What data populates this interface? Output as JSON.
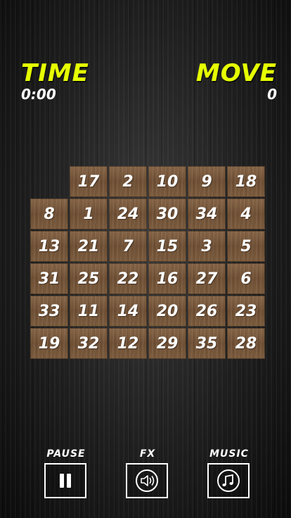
{
  "hud": {
    "time_label": "TIME",
    "time_value": "0:00",
    "move_label": "MOVE",
    "move_value": "0"
  },
  "board": {
    "rows": 6,
    "cols": 6,
    "empty_index": 0,
    "tiles": [
      "",
      "17",
      "2",
      "10",
      "9",
      "18",
      "8",
      "1",
      "24",
      "30",
      "34",
      "4",
      "13",
      "21",
      "7",
      "15",
      "3",
      "5",
      "31",
      "25",
      "22",
      "16",
      "27",
      "6",
      "33",
      "11",
      "14",
      "20",
      "26",
      "23",
      "19",
      "32",
      "12",
      "29",
      "35",
      "28"
    ]
  },
  "controls": {
    "pause_label": "PAUSE",
    "fx_label": "FX",
    "music_label": "MUSIC",
    "pause_icon": "pause-icon",
    "fx_icon": "speaker-icon",
    "music_icon": "music-note-icon"
  },
  "colors": {
    "accent": "#e6ff00",
    "text": "#ffffff",
    "tile": "#7a5a3c"
  }
}
